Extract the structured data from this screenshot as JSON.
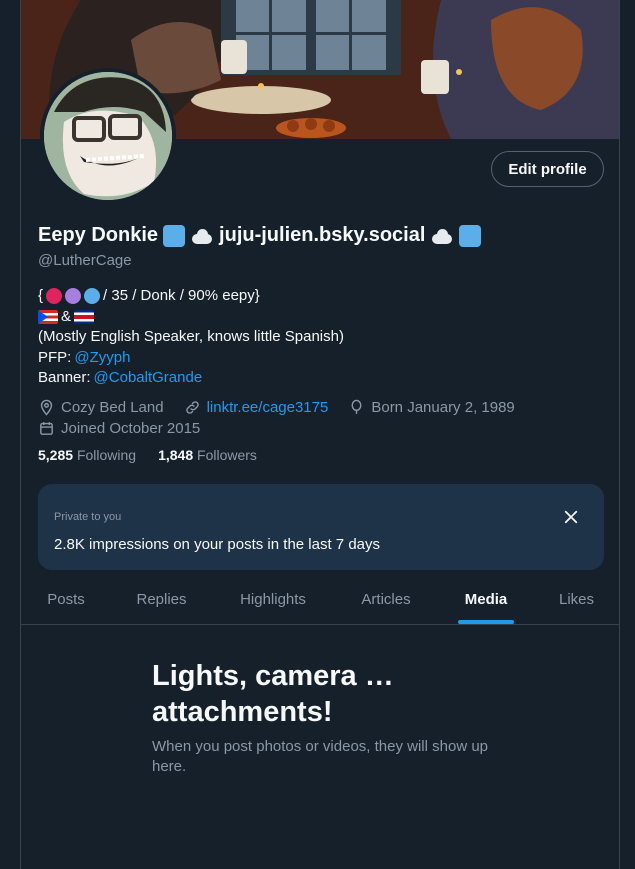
{
  "profile": {
    "edit_label": "Edit profile",
    "name_part1": "Eepy Donkie",
    "name_part2": "juju-julien.bsky.social",
    "handle": "@LutherCage"
  },
  "bio": {
    "line1_text": "/ 35 / Donk / 90% eepy}",
    "line1_open": "{",
    "line2_amp": "&",
    "line3": "(Mostly English Speaker, knows little Spanish)",
    "pfp_label": "PFP:",
    "pfp_link": "@Zyyph",
    "banner_label": "Banner:",
    "banner_link": "@CobaltGrande"
  },
  "meta": {
    "location": "Cozy Bed Land",
    "website": "linktr.ee/cage3175",
    "born": "Born January 2, 1989",
    "joined": "Joined October 2015"
  },
  "stats": {
    "following_count": "5,285",
    "following_label": "Following",
    "followers_count": "1,848",
    "followers_label": "Followers"
  },
  "private_card": {
    "label": "Private to you",
    "text": "2.8K impressions on your posts in the last 7 days"
  },
  "tabs": [
    {
      "label": "Posts"
    },
    {
      "label": "Replies"
    },
    {
      "label": "Highlights"
    },
    {
      "label": "Articles"
    },
    {
      "label": "Media"
    },
    {
      "label": "Likes"
    }
  ],
  "active_tab": "Media",
  "empty_state": {
    "title": "Lights, camera … attachments!",
    "subtitle": "When you post photos or videos, they will show up here."
  },
  "colors": {
    "background": "#15202b",
    "accent": "#1d9bf0",
    "card": "#1e3348"
  },
  "icons": [
    "location-icon",
    "link-icon",
    "balloon-icon",
    "calendar-icon",
    "close-icon"
  ]
}
